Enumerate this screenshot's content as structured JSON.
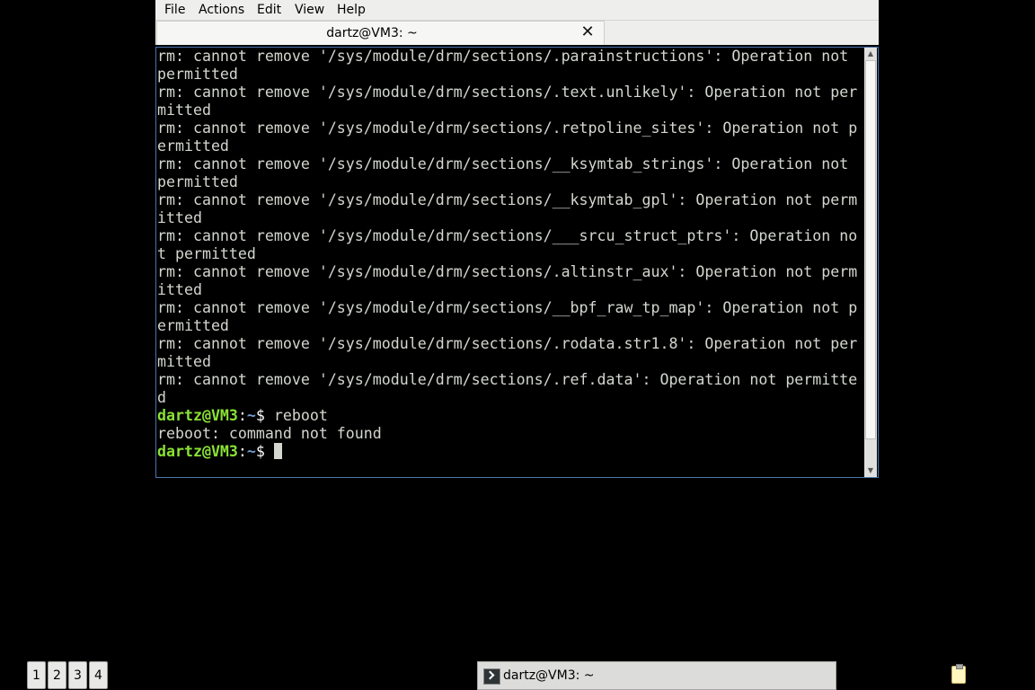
{
  "window": {
    "menu": [
      "File",
      "Actions",
      "Edit",
      "View",
      "Help"
    ],
    "tab_title": "dartz@VM3: ~",
    "tab_close": "✕"
  },
  "terminal": {
    "lines": [
      "rm: cannot remove '/sys/module/drm/sections/.parainstructions': Operation not",
      "permitted",
      "rm: cannot remove '/sys/module/drm/sections/.text.unlikely': Operation not per",
      "mitted",
      "rm: cannot remove '/sys/module/drm/sections/.retpoline_sites': Operation not p",
      "ermitted",
      "rm: cannot remove '/sys/module/drm/sections/__ksymtab_strings': Operation not",
      "permitted",
      "rm: cannot remove '/sys/module/drm/sections/__ksymtab_gpl': Operation not perm",
      "itted",
      "rm: cannot remove '/sys/module/drm/sections/___srcu_struct_ptrs': Operation no",
      "t permitted",
      "rm: cannot remove '/sys/module/drm/sections/.altinstr_aux': Operation not perm",
      "itted",
      "rm: cannot remove '/sys/module/drm/sections/__bpf_raw_tp_map': Operation not p",
      "ermitted",
      "rm: cannot remove '/sys/module/drm/sections/.rodata.str1.8': Operation not per",
      "mitted",
      "rm: cannot remove '/sys/module/drm/sections/.ref.data': Operation not permitte",
      "d"
    ],
    "prompt_user": "dartz@VM3",
    "prompt_sep": ":",
    "prompt_path": "~",
    "prompt_dollar": "$ ",
    "command": "reboot",
    "output": "reboot: command not found",
    "colors": {
      "user": "#8ae234",
      "path": "#729fcf",
      "text": "#d3d7cf",
      "background": "#000000"
    }
  },
  "panel": {
    "workspaces": [
      "1",
      "2",
      "3",
      "4"
    ],
    "task_label": "dartz@VM3: ~",
    "task_icon": "terminal-icon",
    "tray_icon": "clipboard-icon"
  }
}
